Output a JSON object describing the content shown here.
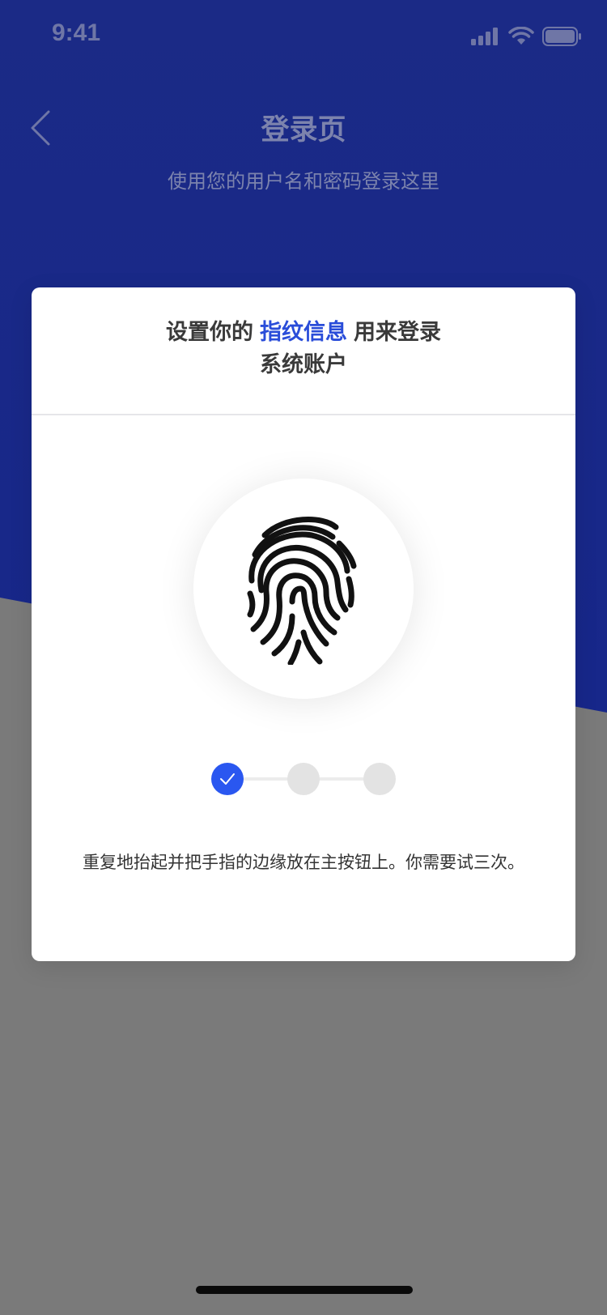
{
  "status_bar": {
    "time": "9:41",
    "icons": [
      "signal-icon",
      "wifi-icon",
      "battery-icon"
    ]
  },
  "header": {
    "back_icon": "chevron-left-icon",
    "title": "登录页",
    "subtitle": "使用您的用户名和密码登录这里"
  },
  "card": {
    "heading_prefix": "设置你的",
    "heading_highlight": "指纹信息",
    "heading_suffix": "用来登录",
    "heading_line2": "系统账户",
    "fingerprint_icon": "fingerprint-icon",
    "steps": [
      {
        "state": "done",
        "icon": "check-icon"
      },
      {
        "state": "pending"
      },
      {
        "state": "pending"
      }
    ],
    "instruction": "重复地抬起并把手指的边缘放在主按钮上。你需要试三次。"
  },
  "colors": {
    "header_blue": "#1a2d8c",
    "header_blue_dark": "#14257a",
    "page_gray": "#7a7a7a",
    "accent": "#2a4dd9",
    "step_done": "#2a57f0",
    "step_pending": "#e3e3e3"
  }
}
